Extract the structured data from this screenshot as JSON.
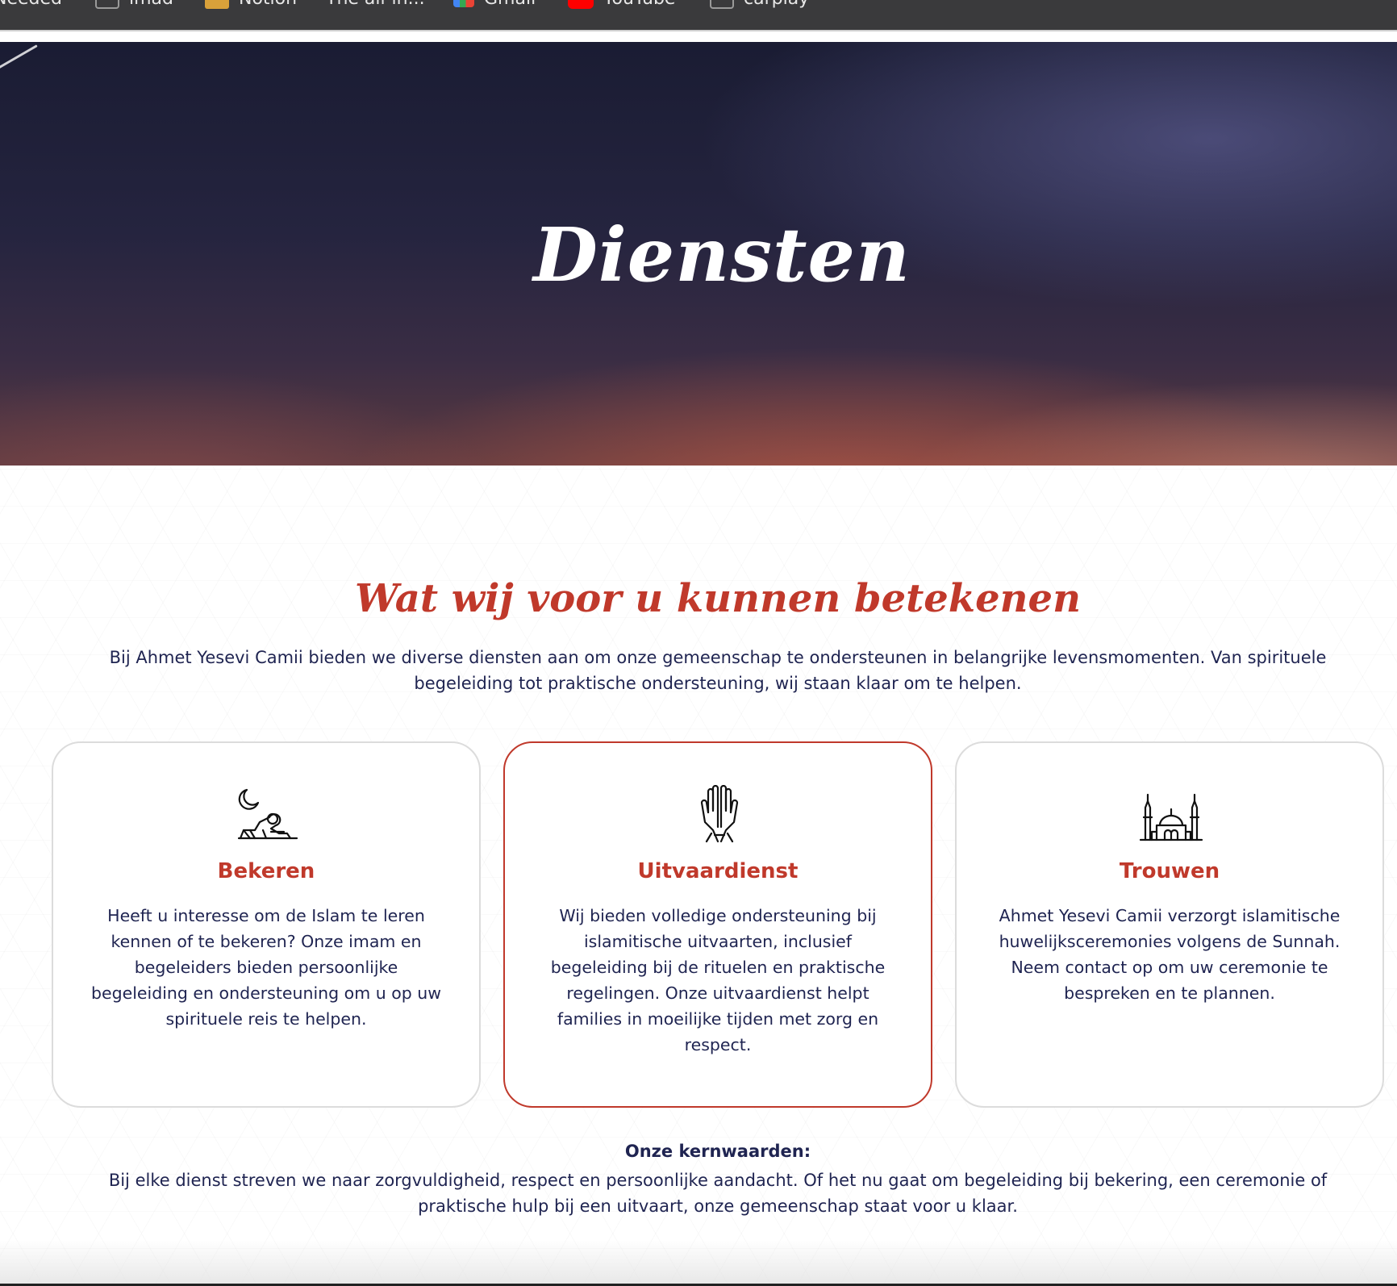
{
  "bookmarks": [
    {
      "label": "Needed",
      "icon": "none"
    },
    {
      "label": "imad",
      "icon": "folder-icon"
    },
    {
      "label": "Notion",
      "icon": "notion-icon"
    },
    {
      "label": "The all-in...",
      "icon": "none"
    },
    {
      "label": "Gmail",
      "icon": "gmail-icon"
    },
    {
      "label": "YouTube",
      "icon": "youtube-icon"
    },
    {
      "label": "carplay",
      "icon": "folder-icon"
    }
  ],
  "hero": {
    "title": "Diensten"
  },
  "section": {
    "heading": "Wat wij voor u kunnen betekenen",
    "intro": "Bij Ahmet Yesevi Camii bieden we diverse diensten aan om onze gemeenschap te ondersteunen in belangrijke levensmomenten. Van spirituele begeleiding tot praktische ondersteuning, wij staan klaar om te helpen."
  },
  "cards": [
    {
      "icon": "praying-person-moon-icon",
      "title": "Bekeren",
      "text": "Heeft u interesse om de Islam te leren kennen of te bekeren? Onze imam en begeleiders bieden persoonlijke begeleiding en ondersteuning om u op uw spirituele reis te helpen."
    },
    {
      "icon": "praying-hands-icon",
      "title": "Uitvaardienst",
      "text": "Wij bieden volledige ondersteuning bij islamitische uitvaarten, inclusief begeleiding bij de rituelen en praktische regelingen. Onze uitvaardienst helpt families in moeilijke tijden met zorg en respect."
    },
    {
      "icon": "mosque-icon",
      "title": "Trouwen",
      "text": "Ahmet Yesevi Camii verzorgt islamitische huwelijksceremonies volgens de Sunnah. Neem contact op om uw ceremonie te bespreken en te plannen."
    }
  ],
  "values": {
    "heading": "Onze kernwaarden:",
    "text": "Bij elke dienst streven we naar zorgvuldigheid, respect en persoonlijke aandacht. Of het nu gaat om begeleiding bij bekering, een ceremonie of praktische hulp bij een uitvaart, onze gemeenschap staat voor u klaar."
  },
  "colors": {
    "accent": "#c0392b",
    "text": "#1f2451",
    "card_border": "#dcdcdc"
  }
}
